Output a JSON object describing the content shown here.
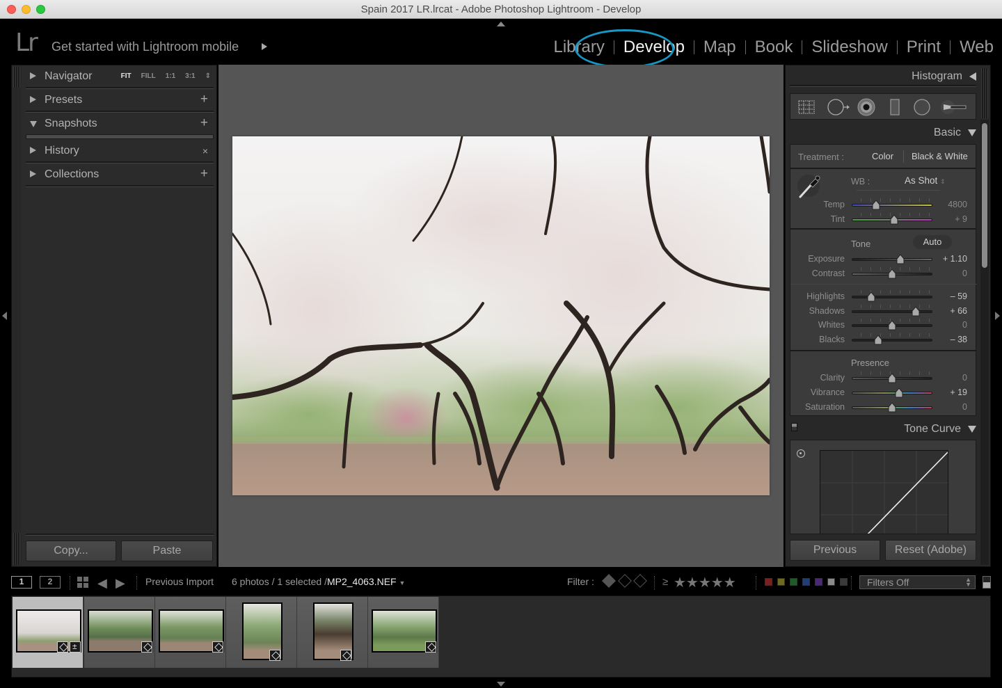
{
  "window": {
    "title": "Spain 2017 LR.lrcat - Adobe Photoshop Lightroom - Develop"
  },
  "topbar": {
    "logo": "Lr",
    "mobile_prompt": "Get started with Lightroom mobile",
    "modules": [
      "Library",
      "Develop",
      "Map",
      "Book",
      "Slideshow",
      "Print",
      "Web"
    ],
    "active_module": "Develop",
    "highlight_color": "#1797c2"
  },
  "left_panel": {
    "navigator": {
      "label": "Navigator",
      "zoom_options": [
        "FIT",
        "FILL",
        "1:1",
        "3:1"
      ],
      "selected_zoom": "FIT"
    },
    "sections": [
      {
        "label": "Presets",
        "action": "+",
        "expanded": false
      },
      {
        "label": "Snapshots",
        "action": "+",
        "expanded": true
      },
      {
        "label": "History",
        "action": "×",
        "expanded": false
      },
      {
        "label": "Collections",
        "action": "+",
        "expanded": false
      }
    ],
    "copy_label": "Copy...",
    "paste_label": "Paste"
  },
  "right_panel": {
    "histogram_label": "Histogram",
    "tools": [
      "crop-overlay-icon",
      "spot-removal-icon",
      "red-eye-icon",
      "graduated-filter-icon",
      "radial-filter-icon",
      "adjustment-brush-icon"
    ],
    "basic": {
      "label": "Basic",
      "treatment_label": "Treatment :",
      "treatment_options": [
        "Color",
        "Black & White"
      ],
      "selected_treatment": "Color",
      "wb_label": "WB :",
      "wb_value": "As Shot",
      "temp": {
        "label": "Temp",
        "value": "4800",
        "position": 0.3
      },
      "tint": {
        "label": "Tint",
        "value": "+ 9",
        "position": 0.53
      },
      "tone_label": "Tone",
      "auto_label": "Auto",
      "exposure": {
        "label": "Exposure",
        "value": "+ 1.10",
        "position": 0.6
      },
      "contrast": {
        "label": "Contrast",
        "value": "0",
        "position": 0.5
      },
      "highlights": {
        "label": "Highlights",
        "value": "– 59",
        "position": 0.24
      },
      "shadows": {
        "label": "Shadows",
        "value": "+ 66",
        "position": 0.79
      },
      "whites": {
        "label": "Whites",
        "value": "0",
        "position": 0.5
      },
      "blacks": {
        "label": "Blacks",
        "value": "– 38",
        "position": 0.33
      },
      "presence_label": "Presence",
      "clarity": {
        "label": "Clarity",
        "value": "0",
        "position": 0.5
      },
      "vibrance": {
        "label": "Vibrance",
        "value": "+ 19",
        "position": 0.59
      },
      "saturation": {
        "label": "Saturation",
        "value": "0",
        "position": 0.5
      }
    },
    "tone_curve_label": "Tone Curve",
    "previous_label": "Previous",
    "reset_label": "Reset (Adobe)"
  },
  "toolbar": {
    "screen1": "1",
    "screen2": "2",
    "source": "Previous Import",
    "count": "6 photos / 1 selected /",
    "filename": "MP2_4063.NEF",
    "filter_label": "Filter :",
    "rating_op": "≥",
    "stars": "★★★★★",
    "color_labels": [
      "#7a2020",
      "#6e6a22",
      "#215a2a",
      "#213d72",
      "#4a2a72",
      "#8a8a8a",
      "#3a3a3a"
    ],
    "filters_value": "Filters Off"
  },
  "filmstrip": {
    "count": 6,
    "selected_index": 0
  }
}
